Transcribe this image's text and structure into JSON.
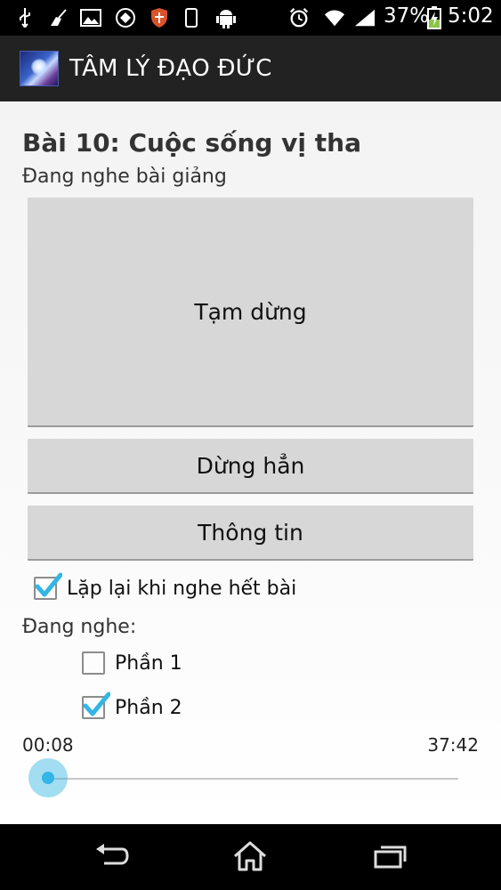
{
  "status_bar": {
    "icons": [
      "usb-icon",
      "broom-icon",
      "image-icon",
      "sync-icon",
      "shield-icon",
      "phone-icon",
      "android-icon",
      "alarm-icon",
      "wifi-icon",
      "signal-icon",
      "battery-charging-icon"
    ],
    "battery": "37%",
    "time": "5:02"
  },
  "action_bar": {
    "title": "TÂM LÝ ĐẠO ĐỨC"
  },
  "main": {
    "lesson_title": "Bài 10: Cuộc sống vị tha",
    "status_text": "Đang nghe bài giảng",
    "pause_button": "Tạm dừng",
    "stop_button": "Dừng hẳn",
    "info_button": "Thông tin",
    "repeat_label": "Lặp lại khi nghe hết bài",
    "repeat_checked": true,
    "listening_label": "Đang nghe:",
    "parts": [
      {
        "label": "Phần 1",
        "checked": false
      },
      {
        "label": "Phần 2",
        "checked": true
      }
    ],
    "current_time": "00:08",
    "total_time": "37:42",
    "progress": 0.0036
  },
  "nav_bar": {
    "buttons": [
      "back-icon",
      "home-icon",
      "recent-apps-icon"
    ]
  },
  "colors": {
    "accent": "#33b5e5",
    "action_bar": "#222222",
    "button": "#d7d7d8"
  }
}
